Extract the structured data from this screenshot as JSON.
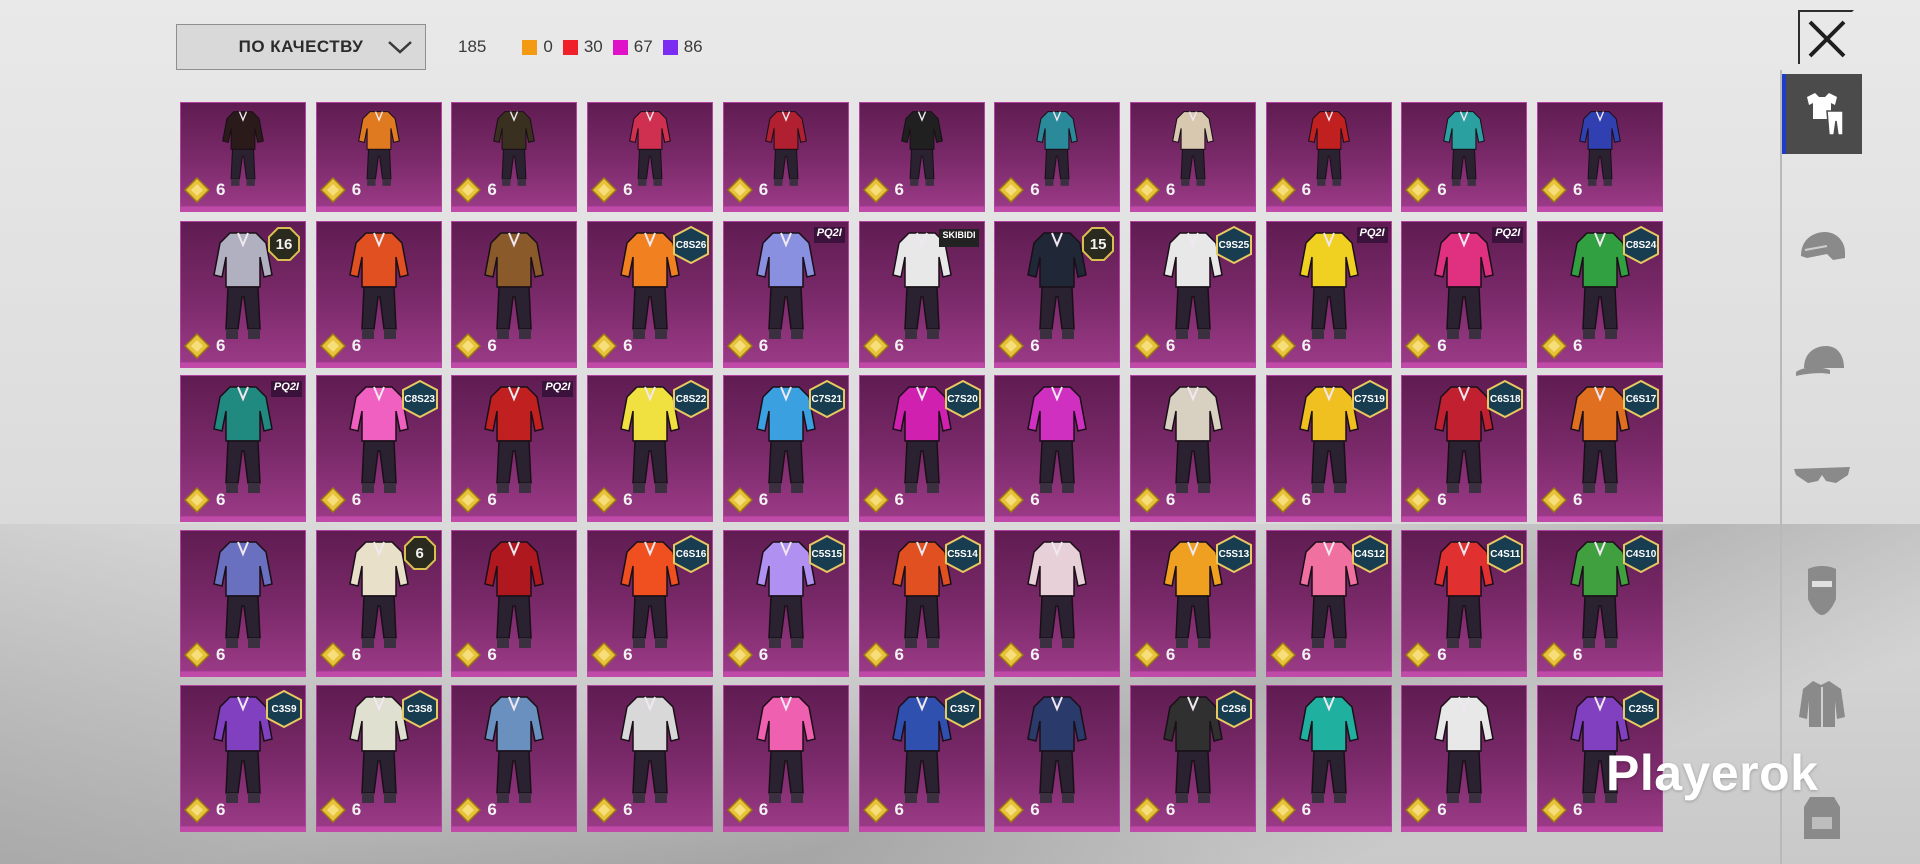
{
  "filter": {
    "selected": "ПО КАЧЕСТВУ"
  },
  "stats": {
    "total": "185",
    "counts": [
      {
        "color": "#f39a12",
        "value": "0"
      },
      {
        "color": "#f0202a",
        "value": "30"
      },
      {
        "color": "#e012c8",
        "value": "67"
      },
      {
        "color": "#7b2cf0",
        "value": "86"
      }
    ]
  },
  "close_icon": "close-icon",
  "sidebar": {
    "items": [
      {
        "name": "outfit-tab",
        "icon": "shirt-pants-icon",
        "active": true
      },
      {
        "name": "helmet-tab",
        "icon": "helmet-icon",
        "active": false
      },
      {
        "name": "cap-tab",
        "icon": "cap-icon",
        "active": false
      },
      {
        "name": "glasses-tab",
        "icon": "glasses-icon",
        "active": false
      },
      {
        "name": "mask-tab",
        "icon": "mask-icon",
        "active": false
      },
      {
        "name": "jacket-tab",
        "icon": "jacket-icon",
        "active": false
      },
      {
        "name": "backpack-tab",
        "icon": "backpack-icon",
        "active": false
      }
    ]
  },
  "watermark": "Playerok",
  "items": [
    {
      "qty": "6",
      "badge": "",
      "accent": "#2a1a1a"
    },
    {
      "qty": "6",
      "badge": "",
      "accent": "#e07a20"
    },
    {
      "qty": "6",
      "badge": "",
      "accent": "#3a3020"
    },
    {
      "qty": "6",
      "badge": "",
      "accent": "#d03050"
    },
    {
      "qty": "6",
      "badge": "",
      "accent": "#b02030"
    },
    {
      "qty": "6",
      "badge": "",
      "accent": "#202020"
    },
    {
      "qty": "6",
      "badge": "",
      "accent": "#2a8a9a"
    },
    {
      "qty": "6",
      "badge": "",
      "accent": "#d8c8b0"
    },
    {
      "qty": "6",
      "badge": "",
      "accent": "#c02020"
    },
    {
      "qty": "6",
      "badge": "",
      "accent": "#2aa0a0"
    },
    {
      "qty": "6",
      "badge": "",
      "accent": "#3040b0"
    },
    {
      "qty": "6",
      "badge": "16",
      "badge_type": "oct",
      "accent": "#b0b0c0"
    },
    {
      "qty": "6",
      "badge": "",
      "accent": "#e05020"
    },
    {
      "qty": "6",
      "badge": "",
      "accent": "#8a5a2a"
    },
    {
      "qty": "6",
      "badge": "C8S26",
      "badge_type": "hex",
      "accent": "#f08020"
    },
    {
      "qty": "6",
      "badge": "PQ2I",
      "badge_type": "txt",
      "accent": "#8a90e0"
    },
    {
      "qty": "6",
      "badge": "SKIBIDI",
      "badge_type": "bar",
      "accent": "#e8e8e8"
    },
    {
      "qty": "6",
      "badge": "15",
      "badge_type": "oct",
      "accent": "#202838"
    },
    {
      "qty": "6",
      "badge": "C9S25",
      "badge_type": "hex",
      "accent": "#e8e8e8"
    },
    {
      "qty": "6",
      "badge": "PQ2I",
      "badge_type": "txt",
      "accent": "#f0d020"
    },
    {
      "qty": "6",
      "badge": "PQ2I",
      "badge_type": "txt",
      "accent": "#e03080"
    },
    {
      "qty": "6",
      "badge": "C8S24",
      "badge_type": "hex",
      "accent": "#30a040"
    },
    {
      "qty": "6",
      "badge": "PQ2I",
      "badge_type": "txt",
      "accent": "#208a80"
    },
    {
      "qty": "6",
      "badge": "C8S23",
      "badge_type": "hex",
      "accent": "#f060c0"
    },
    {
      "qty": "6",
      "badge": "PQ2I",
      "badge_type": "txt",
      "accent": "#c02020"
    },
    {
      "qty": "6",
      "badge": "C8S22",
      "badge_type": "hex",
      "accent": "#f0e040"
    },
    {
      "qty": "6",
      "badge": "C7S21",
      "badge_type": "hex",
      "accent": "#3aa0e0"
    },
    {
      "qty": "6",
      "badge": "C7S20",
      "badge_type": "hex",
      "accent": "#d020b0"
    },
    {
      "qty": "6",
      "badge": "",
      "accent": "#d030c0"
    },
    {
      "qty": "6",
      "badge": "",
      "accent": "#d8d0c0"
    },
    {
      "qty": "6",
      "badge": "C7S19",
      "badge_type": "hex",
      "accent": "#f0c020"
    },
    {
      "qty": "6",
      "badge": "C6S18",
      "badge_type": "hex",
      "accent": "#c02030"
    },
    {
      "qty": "6",
      "badge": "C6S17",
      "badge_type": "hex",
      "accent": "#e07020"
    },
    {
      "qty": "6",
      "badge": "",
      "accent": "#6a70c0"
    },
    {
      "qty": "6",
      "badge": "6",
      "badge_type": "oct",
      "accent": "#e8e0c8"
    },
    {
      "qty": "6",
      "badge": "",
      "accent": "#b01820"
    },
    {
      "qty": "6",
      "badge": "C6S16",
      "badge_type": "hex",
      "accent": "#f05020"
    },
    {
      "qty": "6",
      "badge": "C5S15",
      "badge_type": "hex",
      "accent": "#b090f0"
    },
    {
      "qty": "6",
      "badge": "C5S14",
      "badge_type": "hex",
      "accent": "#e05020"
    },
    {
      "qty": "6",
      "badge": "",
      "accent": "#e8d0d8"
    },
    {
      "qty": "6",
      "badge": "C5S13",
      "badge_type": "hex",
      "accent": "#f0a020"
    },
    {
      "qty": "6",
      "badge": "C4S12",
      "badge_type": "hex",
      "accent": "#f070a0"
    },
    {
      "qty": "6",
      "badge": "C4S11",
      "badge_type": "hex",
      "accent": "#e03030"
    },
    {
      "qty": "6",
      "badge": "C4S10",
      "badge_type": "hex",
      "accent": "#40a040"
    },
    {
      "qty": "6",
      "badge": "C3S9",
      "badge_type": "hex",
      "accent": "#8040c0"
    },
    {
      "qty": "6",
      "badge": "C3S8",
      "badge_type": "hex",
      "accent": "#e0e0d0"
    },
    {
      "qty": "6",
      "badge": "",
      "accent": "#6a90c0"
    },
    {
      "qty": "6",
      "badge": "",
      "accent": "#d8d8d8"
    },
    {
      "qty": "6",
      "badge": "",
      "accent": "#f060b0"
    },
    {
      "qty": "6",
      "badge": "C3S7",
      "badge_type": "hex",
      "accent": "#3050b0"
    },
    {
      "qty": "6",
      "badge": "",
      "accent": "#2a3a6a"
    },
    {
      "qty": "6",
      "badge": "C2S6",
      "badge_type": "hex",
      "accent": "#303030"
    },
    {
      "qty": "6",
      "badge": "",
      "accent": "#20b0a0"
    },
    {
      "qty": "6",
      "badge": "",
      "accent": "#e8e8e8"
    },
    {
      "qty": "6",
      "badge": "C2S5",
      "badge_type": "hex",
      "accent": "#8040c0"
    }
  ]
}
